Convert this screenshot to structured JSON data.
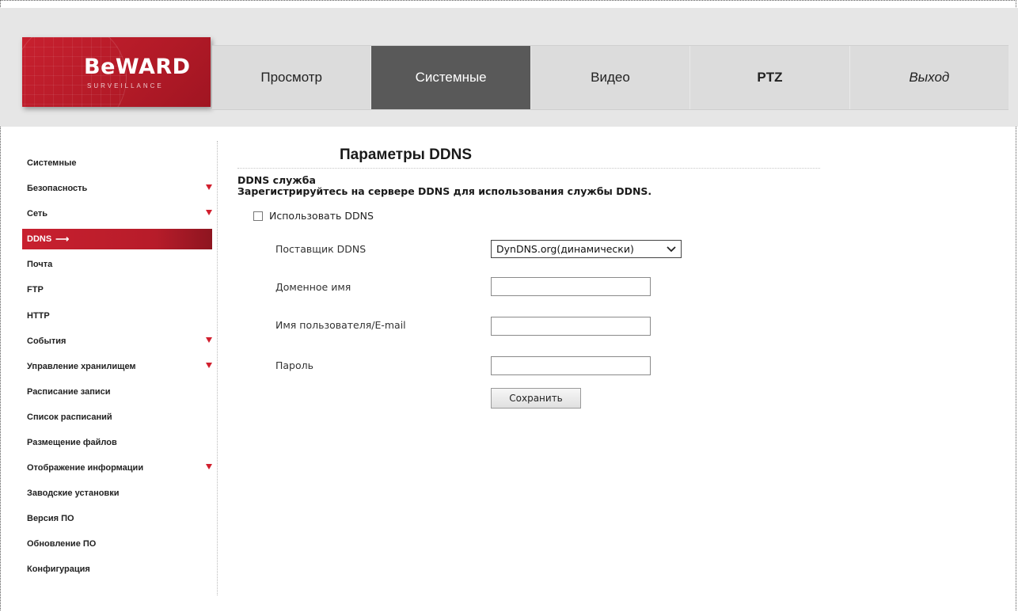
{
  "brand": {
    "name": "BeWARD",
    "tagline": "SURVEILLANCE",
    "accent_color": "#c8202f"
  },
  "nav": {
    "tabs": [
      {
        "label": "Просмотр",
        "active": false
      },
      {
        "label": "Системные",
        "active": true
      },
      {
        "label": "Видео",
        "active": false
      },
      {
        "label": "PTZ",
        "active": false
      },
      {
        "label": "Выход",
        "active": false
      }
    ]
  },
  "sidebar": {
    "items": [
      {
        "label": "Системные",
        "has_submenu": false
      },
      {
        "label": "Безопасность",
        "has_submenu": true
      },
      {
        "label": "Сеть",
        "has_submenu": true
      },
      {
        "label": "DDNS",
        "has_submenu": false,
        "active": true,
        "marker_icon": "arrow-right-icon"
      },
      {
        "label": "Почта",
        "has_submenu": false
      },
      {
        "label": "FTP",
        "has_submenu": false
      },
      {
        "label": "HTTP",
        "has_submenu": false
      },
      {
        "label": "События",
        "has_submenu": true
      },
      {
        "label": "Управление хранилищем",
        "has_submenu": true
      },
      {
        "label": "Расписание записи",
        "has_submenu": false
      },
      {
        "label": "Список расписаний",
        "has_submenu": false
      },
      {
        "label": "Размещение файлов",
        "has_submenu": false
      },
      {
        "label": "Отображение информации",
        "has_submenu": true
      },
      {
        "label": "Заводские установки",
        "has_submenu": false
      },
      {
        "label": "Версия ПО",
        "has_submenu": false
      },
      {
        "label": "Обновление ПО",
        "has_submenu": false
      },
      {
        "label": "Конфигурация",
        "has_submenu": false
      }
    ]
  },
  "page": {
    "title": "Параметры DDNS",
    "section_title": "DDNS служба",
    "section_desc": "Зарегистрируйтесь на сервере DDNS для использования службы DDNS.",
    "use_ddns": {
      "label": "Использовать DDNS",
      "checked": false
    },
    "provider": {
      "label": "Поставщик DDNS",
      "value": "DynDNS.org(динамически)"
    },
    "domain": {
      "label": "Доменное имя",
      "value": ""
    },
    "username": {
      "label": "Имя пользователя/E-mail",
      "value": ""
    },
    "password": {
      "label": "Пароль",
      "value": ""
    },
    "save_label": "Сохранить"
  }
}
